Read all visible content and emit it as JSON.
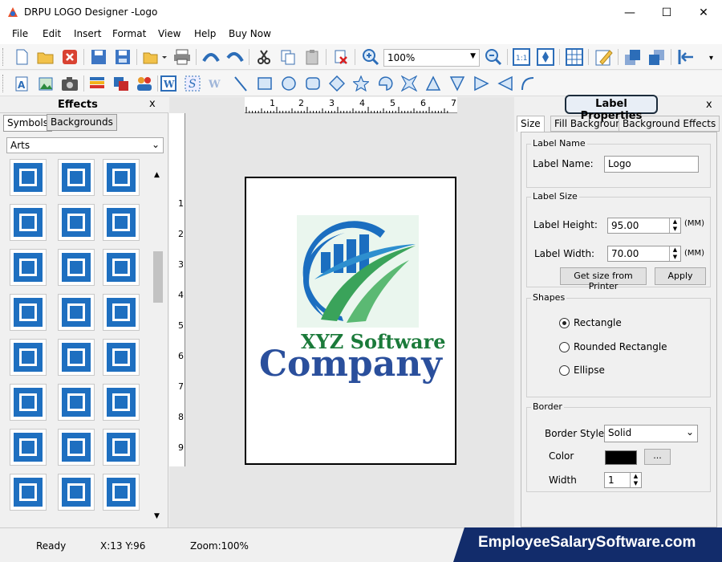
{
  "window": {
    "title": "DRPU LOGO Designer -Logo",
    "minimize": "—",
    "maximize": "☐",
    "close": "✕"
  },
  "menu": [
    "File",
    "Edit",
    "Insert",
    "Format",
    "View",
    "Help",
    "Buy Now"
  ],
  "toolbar": {
    "zoom_value": "100%"
  },
  "effects": {
    "title": "Effects",
    "close": "x",
    "tabs": [
      "Symbols",
      "Backgrounds"
    ],
    "category": "Arts"
  },
  "canvas": {
    "ruler_h": [
      "1",
      "2",
      "3",
      "4",
      "5",
      "6",
      "7"
    ],
    "ruler_v": [
      "1",
      "2",
      "3",
      "4",
      "5",
      "6",
      "7",
      "8",
      "9"
    ],
    "logo_line1": "XYZ Software",
    "logo_line2": "Company"
  },
  "props": {
    "title": "Label Properties",
    "close": "x",
    "tabs": [
      "Size",
      "Fill Background",
      "Background Effects"
    ],
    "label_name_group": "Label Name",
    "label_name_label": "Label Name:",
    "label_name_value": "Logo",
    "label_size_group": "Label Size",
    "height_label": "Label Height:",
    "height_value": "95.00",
    "width_label": "Label Width:",
    "width_value": "70.00",
    "unit": "(MM)",
    "printer_button": "Get size from Printer",
    "apply_button": "Apply",
    "shapes_group": "Shapes",
    "shapes": [
      "Rectangle",
      "Rounded Rectangle",
      "Ellipse"
    ],
    "selected_shape": "Rectangle",
    "border_group": "Border",
    "border_style_label": "Border Style",
    "border_style_value": "Solid",
    "color_label": "Color",
    "color_value": "#000000",
    "color_button": "...",
    "width_label2": "Width",
    "border_width_value": "1"
  },
  "status": {
    "ready": "Ready",
    "coords": "X:13  Y:96",
    "zoom": "Zoom:100%"
  },
  "brand": "EmployeeSalarySoftware.com"
}
